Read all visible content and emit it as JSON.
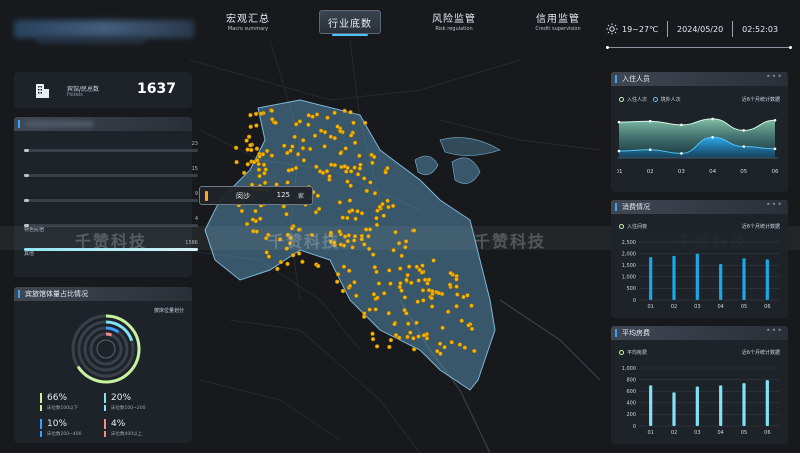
{
  "header": {
    "nav": [
      {
        "cn": "宏观汇总",
        "en": "Macro summary"
      },
      {
        "cn": "行业底数",
        "en": ""
      },
      {
        "cn": "风险监管",
        "en": "Risk regulation"
      },
      {
        "cn": "信用监管",
        "en": "Credit supervision"
      }
    ],
    "weather": {
      "temp": "19~27℃",
      "date": "2024/05/20",
      "time": "02:52:03"
    }
  },
  "hotel_total": {
    "label_cn": "宾馆/民总数",
    "label_en": "Hotels",
    "value": "1637"
  },
  "category_panel": {
    "rows": [
      {
        "label": "",
        "value": "23",
        "fraction": 0.015
      },
      {
        "label": "",
        "value": "15",
        "fraction": 0.01
      },
      {
        "label": "",
        "value": "9",
        "fraction": 0.006
      },
      {
        "label": "特色民宿",
        "value": "4",
        "fraction": 0.003
      },
      {
        "label": "其他",
        "value": "1586",
        "fraction": 1.0
      }
    ]
  },
  "occupancy_panel": {
    "title": "宾旅馆体量占比情况",
    "subtitle": "按床位量划分",
    "stats": [
      {
        "value": "66%",
        "desc": "床位数100以下",
        "color": "#c9f2a0"
      },
      {
        "value": "20%",
        "desc": "床位数100~200",
        "color": "#7fe3f5"
      },
      {
        "value": "10%",
        "desc": "床位数200~400",
        "color": "#3aa0ff"
      },
      {
        "value": "4%",
        "desc": "床位数400以上",
        "color": "#f48a8a"
      }
    ]
  },
  "map": {
    "popup": {
      "district": "闵沙",
      "count": "125",
      "unit": "家"
    },
    "watermark": "千赞科技"
  },
  "residents_panel": {
    "title": "入住人员",
    "legend": [
      "入住人次",
      "境外人次"
    ],
    "note": "近6个月统计数据",
    "x_labels": [
      "01",
      "02",
      "03",
      "04",
      "05",
      "06"
    ]
  },
  "consumption_panel": {
    "title": "消费情况",
    "legend": "入住间夜",
    "note": "近6个月统计数据",
    "accent": "#1aa8e8"
  },
  "avg_price_panel": {
    "title": "平均房费",
    "legend": "平均房费",
    "note": "近6个月统计数据",
    "accent": "#7fe3f5"
  },
  "chart_data": [
    {
      "type": "area",
      "title": "入住人员",
      "categories": [
        "01",
        "02",
        "03",
        "04",
        "05",
        "06"
      ],
      "series": [
        {
          "name": "入住人次",
          "values": [
            0.78,
            0.8,
            0.72,
            0.85,
            0.6,
            0.82
          ]
        },
        {
          "name": "境外人次",
          "values": [
            0.15,
            0.18,
            0.1,
            0.45,
            0.25,
            0.2
          ]
        }
      ],
      "ylim": [
        0,
        1
      ],
      "grid": false,
      "legend": "top-left"
    },
    {
      "type": "bar",
      "title": "消费情况",
      "categories": [
        "01",
        "02",
        "03",
        "04",
        "05",
        "06"
      ],
      "series": [
        {
          "name": "入住间夜",
          "values": [
            1850,
            1900,
            2000,
            1550,
            1800,
            1750
          ]
        }
      ],
      "yticks": [
        "0",
        "500",
        "1,000",
        "1,500",
        "2,000",
        "2,500"
      ],
      "ylim": [
        0,
        2500
      ],
      "grid": true,
      "legend": "top-left"
    },
    {
      "type": "bar",
      "title": "平均房费",
      "categories": [
        "01",
        "02",
        "03",
        "04",
        "05",
        "06"
      ],
      "series": [
        {
          "name": "平均房费",
          "values": [
            700,
            580,
            680,
            700,
            740,
            790
          ]
        }
      ],
      "yticks": [
        "0",
        "200",
        "400",
        "600",
        "800",
        "1,000"
      ],
      "ylim": [
        0,
        1000
      ],
      "grid": true,
      "legend": "top-left"
    }
  ]
}
